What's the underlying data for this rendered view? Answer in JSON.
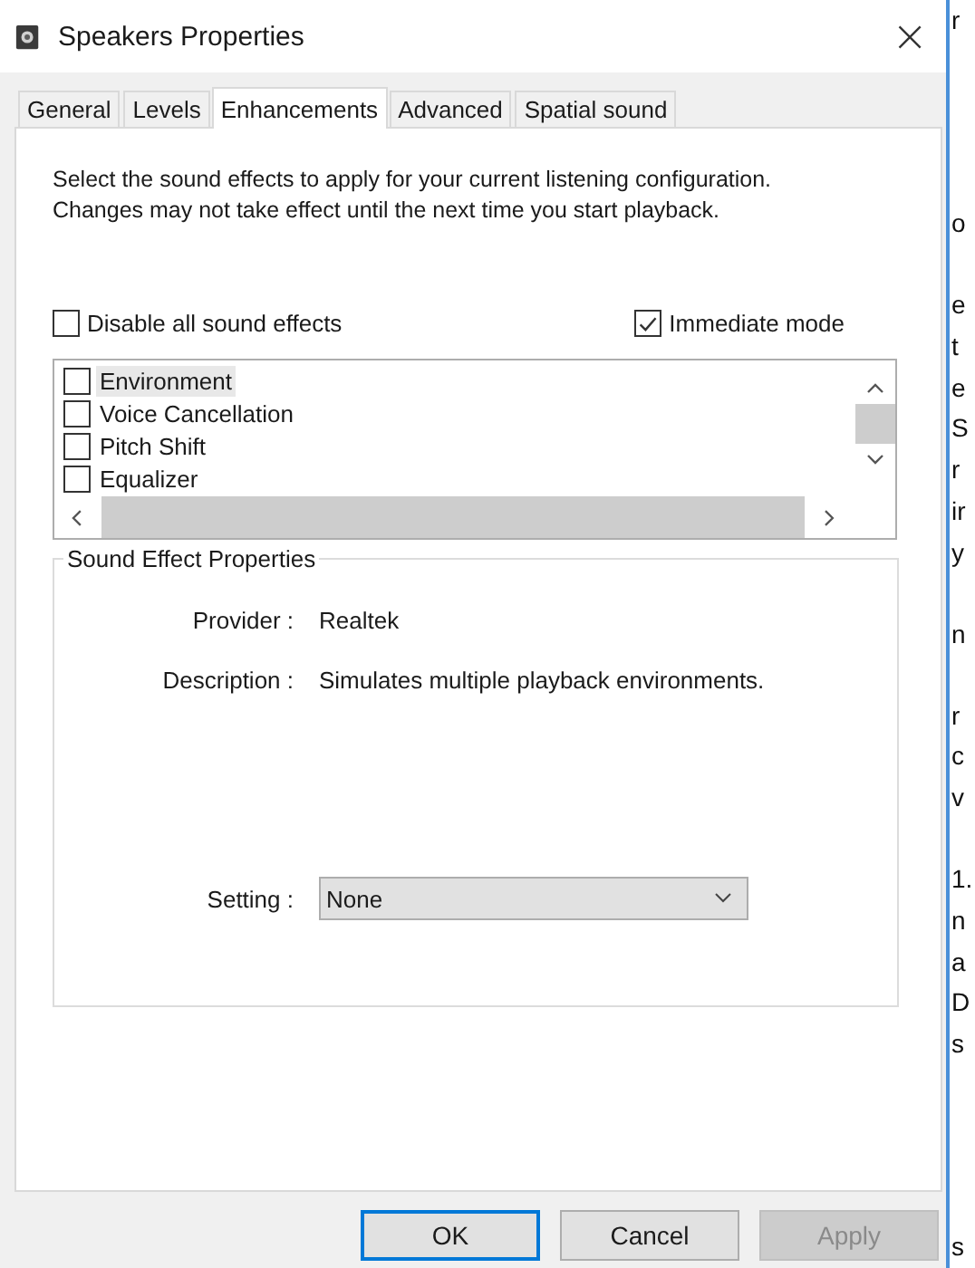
{
  "window": {
    "title": "Speakers Properties",
    "close": "×"
  },
  "tabs": [
    {
      "label": "General",
      "selected": false
    },
    {
      "label": "Levels",
      "selected": false
    },
    {
      "label": "Enhancements",
      "selected": true
    },
    {
      "label": "Advanced",
      "selected": false
    },
    {
      "label": "Spatial sound",
      "selected": false
    }
  ],
  "intro": [
    "Select the sound effects to apply for your current listening configuration.",
    "Changes may not take effect until the next time you start playback."
  ],
  "options": [
    {
      "label": "Disable all sound effects",
      "checked": false
    },
    {
      "label": "Immediate mode",
      "checked": true
    }
  ],
  "effects": [
    {
      "label": "Environment",
      "checked": false,
      "selected": true
    },
    {
      "label": "Voice Cancellation",
      "checked": false,
      "selected": false
    },
    {
      "label": "Pitch Shift",
      "checked": false,
      "selected": false
    },
    {
      "label": "Equalizer",
      "checked": false,
      "selected": false
    }
  ],
  "properties": {
    "title": "Sound Effect Properties",
    "fields": [
      {
        "label": "Provider :",
        "value": "Realtek"
      },
      {
        "label": "Description :",
        "value": "Simulates multiple playback environments."
      }
    ],
    "setting": {
      "label": "Setting :",
      "value": "None"
    }
  },
  "buttons": [
    {
      "label": "OK",
      "kind": "default",
      "disabled": false
    },
    {
      "label": "Cancel",
      "kind": "normal",
      "disabled": false
    },
    {
      "label": "Apply",
      "kind": "normal",
      "disabled": true
    }
  ],
  "background_lines": [
    {
      "kind": "text",
      "text": "r"
    },
    {
      "kind": "gap"
    },
    {
      "kind": "gap"
    },
    {
      "kind": "gap"
    },
    {
      "kind": "gap"
    },
    {
      "kind": "text",
      "text": "o"
    },
    {
      "kind": "gap"
    },
    {
      "kind": "text",
      "text": "e"
    },
    {
      "kind": "text",
      "text": "t"
    },
    {
      "kind": "text",
      "text": "e"
    },
    {
      "kind": "text",
      "text": "S"
    },
    {
      "kind": "text",
      "text": "r"
    },
    {
      "kind": "text",
      "text": "ir"
    },
    {
      "kind": "text",
      "text": "y"
    },
    {
      "kind": "gap"
    },
    {
      "kind": "text",
      "text": "n"
    },
    {
      "kind": "gap"
    },
    {
      "kind": "text",
      "text": "r"
    },
    {
      "kind": "text",
      "text": "c"
    },
    {
      "kind": "text",
      "text": "v"
    },
    {
      "kind": "gap"
    },
    {
      "kind": "text",
      "text": "1."
    },
    {
      "kind": "text",
      "text": "n"
    },
    {
      "kind": "text",
      "text": "a"
    },
    {
      "kind": "text",
      "text": "D"
    },
    {
      "kind": "text",
      "text": "s"
    },
    {
      "kind": "gap"
    },
    {
      "kind": "gap"
    },
    {
      "kind": "gap"
    },
    {
      "kind": "gap"
    },
    {
      "kind": "text",
      "text": "s"
    }
  ]
}
